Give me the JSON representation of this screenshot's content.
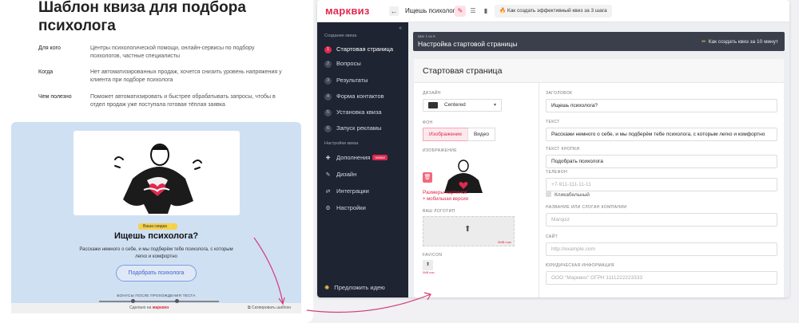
{
  "left": {
    "title": "Шаблон квиза для подбора психолога",
    "rows": [
      {
        "key": "Для кого",
        "value": "Центры психологической помощи, онлайн-сервисы по подбору психологов, частные специалисты"
      },
      {
        "key": "Когда",
        "value": "Нет автоматизированных продаж, хочется снизить уровень напряжения у клиента при подборе психолога"
      },
      {
        "key": "Чем полезно",
        "value": "Поможет автоматизировать и быстрее обрабатывать запросы, чтобы в отдел продаж уже поступала готовая тёплая заявка"
      }
    ],
    "preview": {
      "badge": "Ваша скидка ⭐",
      "title": "Ищешь психолога?",
      "text": "Расскажи немного о себе, и мы подберём тебе психолога, с которым легко и комфортно",
      "button": "Подобрать психолога",
      "bonus": "БОНУСЫ ПОСЛЕ ПРОХОЖДЕНИЯ ТЕСТА",
      "made_prefix": "Сделано на",
      "made_brand": "марквиз",
      "copy": "Скопировать шаблон"
    }
  },
  "app": {
    "logo": "марквиз",
    "quiz_name": "Ищешь психолога?",
    "howto": "Как создать эффективный квиз за 3 шага",
    "sidebar": {
      "collapse": "«",
      "section1": "Создание квиза",
      "steps": [
        {
          "num": "1",
          "label": "Стартовая страница"
        },
        {
          "num": "2",
          "label": "Вопросы"
        },
        {
          "num": "3",
          "label": "Результаты"
        },
        {
          "num": "4",
          "label": "Форма контактов"
        },
        {
          "num": "5",
          "label": "Установка квиза"
        },
        {
          "num": "6",
          "label": "Запуск рекламы"
        }
      ],
      "section2": "Настройки квиза",
      "settings": [
        {
          "icon": "puzzle-icon",
          "glyph": "✚",
          "label": "Дополнения",
          "badge": "новое"
        },
        {
          "icon": "brush-icon",
          "glyph": "✎",
          "label": "Дизайн"
        },
        {
          "icon": "integrations-icon",
          "glyph": "⇄",
          "label": "Интеграции"
        },
        {
          "icon": "gear-icon",
          "glyph": "⚙",
          "label": "Настройки"
        }
      ],
      "idea": "Предложить идею"
    },
    "stepbar": {
      "small": "Шаг 1 из 6",
      "title": "Настройка стартовой страницы",
      "hint": "Как создать квиз за 10 минут"
    },
    "panel": {
      "title": "Стартовая страница",
      "design_label": "ДИЗАЙН",
      "design_value": "Centered",
      "bg_label": "ФОН",
      "bg_options": [
        "Изображение",
        "Видео"
      ],
      "image_label": "ИЗОБРАЖЕНИЕ",
      "sizes": "Размеры картинок",
      "mobile": "+ мобильная версия",
      "logo_label": "ВАШ ЛОГОТИП",
      "logo_mb": "5MB max",
      "favicon_label": "FAVICON",
      "favicon_mb": "5MB max",
      "fields": [
        {
          "label": "ЗАГОЛОВОК",
          "value": "Ищешь психолога?",
          "placeholder": false
        },
        {
          "label": "ТЕКСТ",
          "value": "Расскажи немного о себе, и мы подберём тебе психолога, с которым легко и комфортно",
          "placeholder": false
        },
        {
          "label": "ТЕКСТ КНОПКИ",
          "value": "Подобрать психолога",
          "placeholder": false
        },
        {
          "label": "ТЕЛЕФОН",
          "value": "+7-911-111-11-11",
          "placeholder": true
        }
      ],
      "clickable": "Кликабельный",
      "fields2": [
        {
          "label": "НАЗВАНИЕ ИЛИ СЛОГАН КОМПАНИИ",
          "value": "Marquiz",
          "placeholder": true
        },
        {
          "label": "САЙТ",
          "value": "http://example.com",
          "placeholder": true
        },
        {
          "label": "ЮРИДИЧЕСКАЯ ИНФОРМАЦИЯ",
          "value": "ООО \"Марквиз\" ОГРН 1111222223333",
          "placeholder": true
        }
      ]
    }
  },
  "colors": {
    "brand": "#e0294d",
    "sidebar": "#1f2433",
    "preview_bg": "#cfe0f3"
  }
}
